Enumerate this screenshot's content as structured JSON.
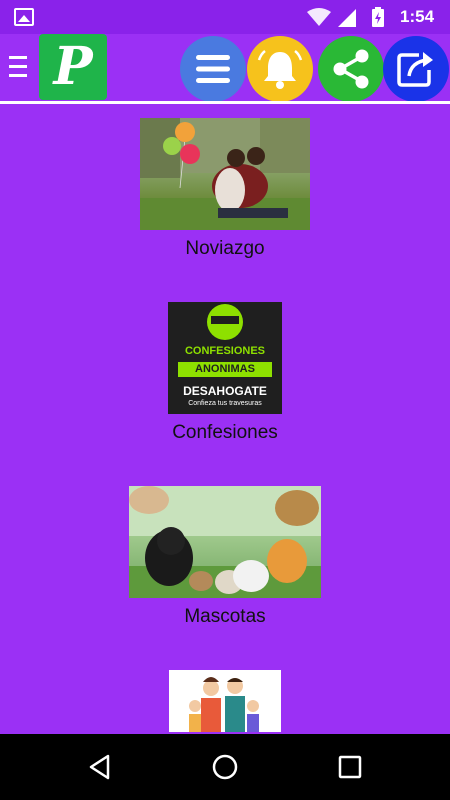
{
  "status_bar": {
    "time": "1:54"
  },
  "toolbar": {
    "logo_text": "P",
    "buttons": [
      "menu-lines-icon",
      "bell-icon",
      "share-icon",
      "open-external-icon"
    ]
  },
  "categories": [
    {
      "label": "Noviazgo",
      "image": "couple-with-balloons"
    },
    {
      "label": "Confesiones",
      "image": "confesiones-anonimas-poster"
    },
    {
      "label": "Mascotas",
      "image": "pets-collage"
    },
    {
      "label": "",
      "image": "family-illustration"
    }
  ],
  "confesiones_poster": {
    "line1": "CONFESIONES",
    "line2": "ANONIMAS",
    "line3": "DESAHOGATE",
    "line4": "Confieza tus travesuras"
  },
  "colors": {
    "background": "#9b30f5",
    "status_bar": "#8a22ea",
    "logo": "#1fb44a",
    "menu_button": "#4a7ae0",
    "bell_button": "#f6c21c",
    "share_button": "#2ab836",
    "open_button": "#1a33e8"
  }
}
